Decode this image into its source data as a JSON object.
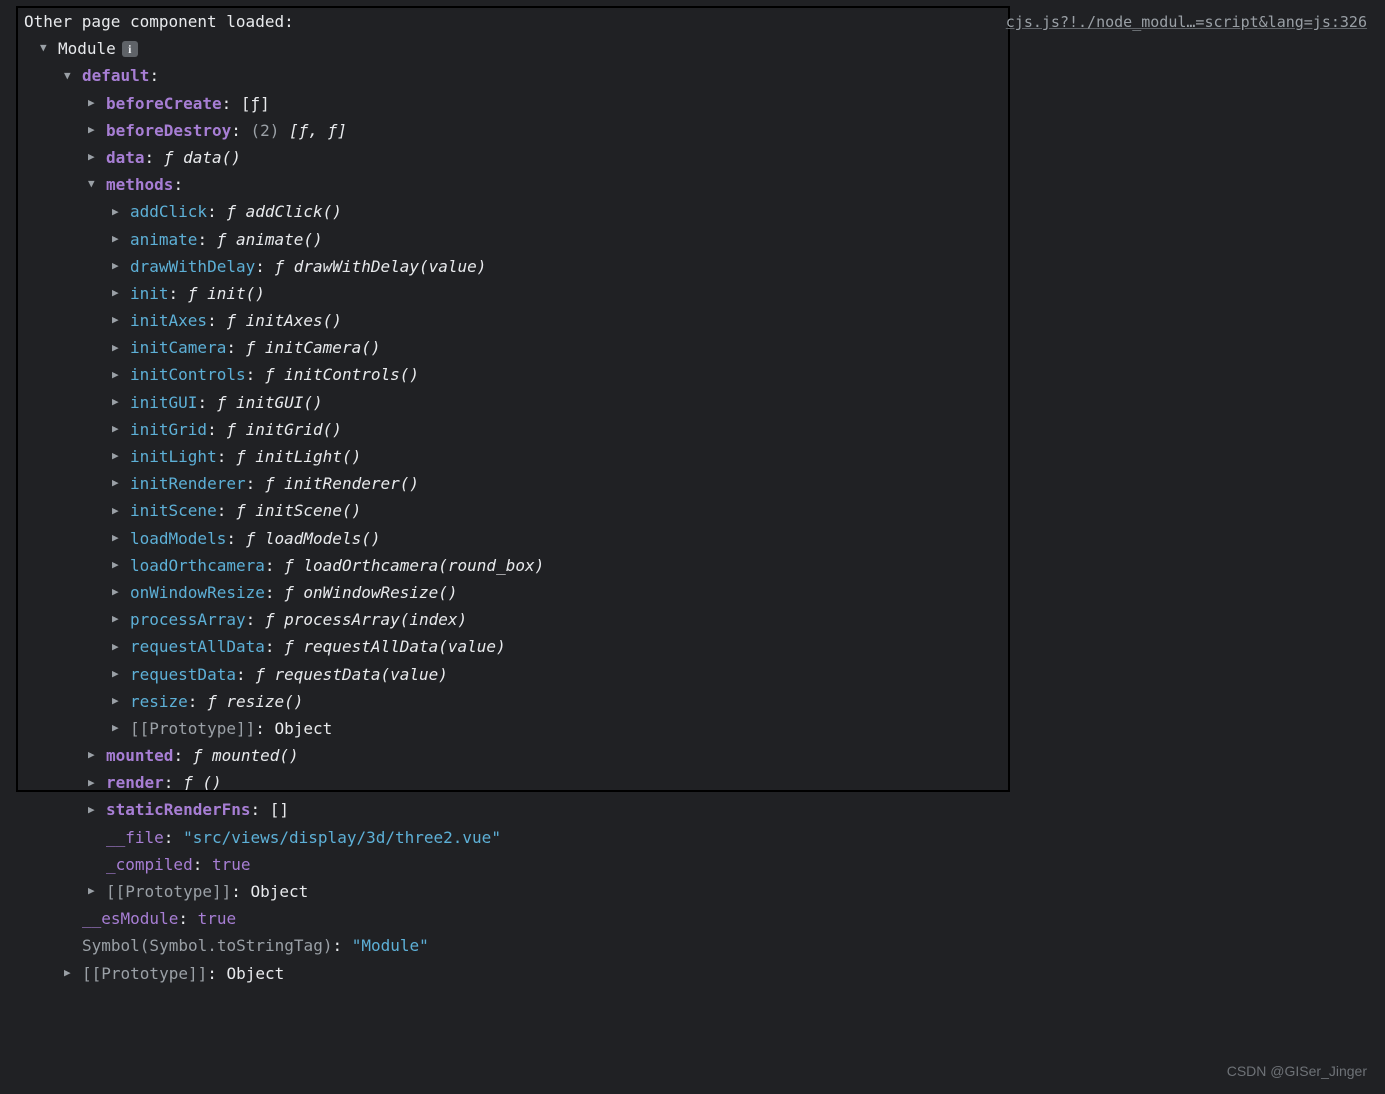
{
  "sourceLink": "cjs.js?!./node_modul…=script&lang=js:326",
  "watermark": "CSDN @GISer_Jinger",
  "logPrefix": "Other page component loaded:",
  "module": {
    "summary": "Module",
    "default": {
      "label": "default",
      "beforeCreate": {
        "name": "beforeCreate",
        "value": "[ƒ]"
      },
      "beforeDestroy": {
        "name": "beforeDestroy",
        "count": "(2)",
        "value": "[ƒ, ƒ]"
      },
      "data": {
        "name": "data",
        "f": "ƒ",
        "sig": "data()"
      },
      "methods": {
        "label": "methods",
        "items": [
          {
            "name": "addClick",
            "f": "ƒ",
            "sig": "addClick()"
          },
          {
            "name": "animate",
            "f": "ƒ",
            "sig": "animate()"
          },
          {
            "name": "drawWithDelay",
            "f": "ƒ",
            "sig": "drawWithDelay(value)"
          },
          {
            "name": "init",
            "f": "ƒ",
            "sig": "init()"
          },
          {
            "name": "initAxes",
            "f": "ƒ",
            "sig": "initAxes()"
          },
          {
            "name": "initCamera",
            "f": "ƒ",
            "sig": "initCamera()"
          },
          {
            "name": "initControls",
            "f": "ƒ",
            "sig": "initControls()"
          },
          {
            "name": "initGUI",
            "f": "ƒ",
            "sig": "initGUI()"
          },
          {
            "name": "initGrid",
            "f": "ƒ",
            "sig": "initGrid()"
          },
          {
            "name": "initLight",
            "f": "ƒ",
            "sig": "initLight()"
          },
          {
            "name": "initRenderer",
            "f": "ƒ",
            "sig": "initRenderer()"
          },
          {
            "name": "initScene",
            "f": "ƒ",
            "sig": "initScene()"
          },
          {
            "name": "loadModels",
            "f": "ƒ",
            "sig": "loadModels()"
          },
          {
            "name": "loadOrthcamera",
            "f": "ƒ",
            "sig": "loadOrthcamera(round_box)"
          },
          {
            "name": "onWindowResize",
            "f": "ƒ",
            "sig": "onWindowResize()"
          },
          {
            "name": "processArray",
            "f": "ƒ",
            "sig": "processArray(index)"
          },
          {
            "name": "requestAllData",
            "f": "ƒ",
            "sig": "requestAllData(value)"
          },
          {
            "name": "requestData",
            "f": "ƒ",
            "sig": "requestData(value)"
          },
          {
            "name": "resize",
            "f": "ƒ",
            "sig": "resize()"
          }
        ],
        "proto": {
          "name": "[[Prototype]]",
          "value": "Object"
        }
      },
      "mounted": {
        "name": "mounted",
        "f": "ƒ",
        "sig": "mounted()"
      },
      "render": {
        "name": "render",
        "f": "ƒ",
        "sig": "()"
      },
      "staticRenderFns": {
        "name": "staticRenderFns",
        "value": "[]"
      },
      "file": {
        "name": "__file",
        "value": "\"src/views/display/3d/three2.vue\""
      },
      "compiled": {
        "name": "_compiled",
        "value": "true"
      },
      "proto": {
        "name": "[[Prototype]]",
        "value": "Object"
      }
    },
    "esModule": {
      "name": "__esModule",
      "value": "true"
    },
    "symbol": {
      "name": "Symbol(Symbol.toStringTag)",
      "value": "\"Module\""
    },
    "proto": {
      "name": "[[Prototype]]",
      "value": "Object"
    }
  }
}
